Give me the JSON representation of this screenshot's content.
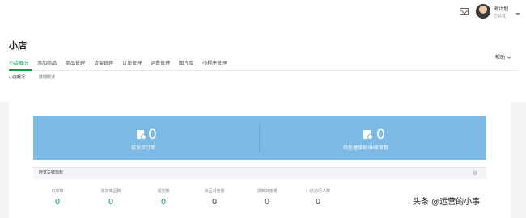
{
  "header": {
    "user_name": "海计划",
    "user_sub": "已认证",
    "icons": [
      "mail-icon",
      "avatar"
    ]
  },
  "page": {
    "title": "小店",
    "help_label": "帮助"
  },
  "tabs": [
    {
      "label": "小店概况",
      "active": true
    },
    {
      "label": "添加商品",
      "active": false
    },
    {
      "label": "商品管理",
      "active": false
    },
    {
      "label": "货架管理",
      "active": false
    },
    {
      "label": "订单管理",
      "active": false
    },
    {
      "label": "运费管理",
      "active": false
    },
    {
      "label": "图片库",
      "active": false
    },
    {
      "label": "小程序管理",
      "active": false
    }
  ],
  "subtabs": [
    {
      "label": "小店概况",
      "active": true
    },
    {
      "label": "数据概述",
      "active": false
    }
  ],
  "stats": [
    {
      "value": "0",
      "label": "待发货订单",
      "icon": "document-icon"
    },
    {
      "value": "0",
      "label": "待处理维权/仲裁单数",
      "icon": "document-icon"
    }
  ],
  "kpi": {
    "title": "昨日关键指标",
    "items": [
      {
        "label": "订单数",
        "value": "0",
        "highlight": true
      },
      {
        "label": "成交商品数",
        "value": "0",
        "highlight": true
      },
      {
        "label": "成交额",
        "value": "0",
        "highlight": true
      },
      {
        "label": "商品浏览量",
        "value": "0",
        "highlight": false
      },
      {
        "label": "货架浏览量",
        "value": "0",
        "highlight": false
      },
      {
        "label": "小店访问人数",
        "value": "0",
        "highlight": false
      }
    ]
  },
  "watermark": "头条 @运营的小事",
  "colors": {
    "accent": "#0e9d4d",
    "stat_panel": "#7cb9e5",
    "highlight_value": "#0ca15b"
  }
}
